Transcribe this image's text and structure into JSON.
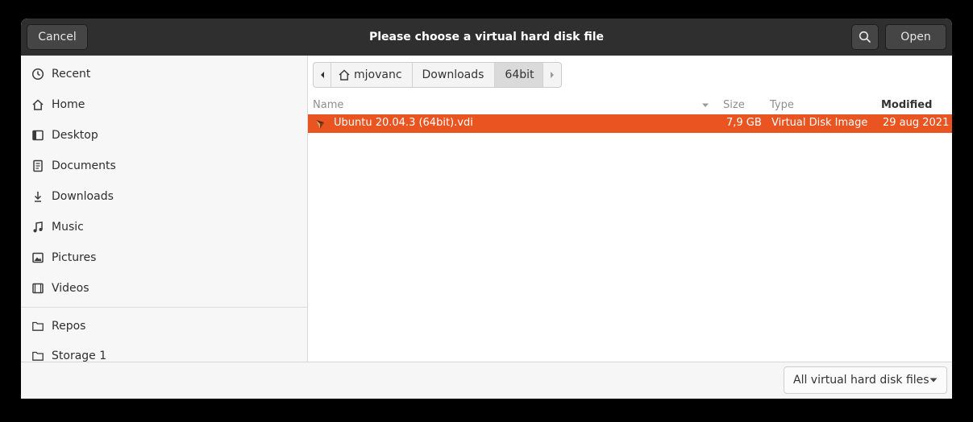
{
  "header": {
    "title": "Please choose a virtual hard disk file",
    "cancel_label": "Cancel",
    "open_label": "Open",
    "search_icon": "search-icon"
  },
  "sidebar": {
    "items": [
      {
        "label": "Recent",
        "icon": "clock-icon"
      },
      {
        "label": "Home",
        "icon": "home-icon"
      },
      {
        "label": "Desktop",
        "icon": "desktop-icon"
      },
      {
        "label": "Documents",
        "icon": "document-icon"
      },
      {
        "label": "Downloads",
        "icon": "download-icon"
      },
      {
        "label": "Music",
        "icon": "music-icon"
      },
      {
        "label": "Pictures",
        "icon": "picture-icon"
      },
      {
        "label": "Videos",
        "icon": "video-icon"
      },
      {
        "label": "Repos",
        "icon": "folder-icon"
      },
      {
        "label": "Storage 1",
        "icon": "folder-icon"
      }
    ]
  },
  "pathbar": {
    "segments": [
      "mjovanc",
      "Downloads",
      "64bit"
    ]
  },
  "columns": {
    "name": "Name",
    "size": "Size",
    "type": "Type",
    "modified": "Modified"
  },
  "files": [
    {
      "name": "Ubuntu 20.04.3 (64bit).vdi",
      "size": "7,9 GB",
      "type": "Virtual Disk Image",
      "modified": "29 aug 2021",
      "selected": true
    }
  ],
  "footer": {
    "filter_label": "All virtual hard disk files"
  },
  "colors": {
    "accent": "#e95420",
    "headerbar": "#2f2f2f"
  }
}
